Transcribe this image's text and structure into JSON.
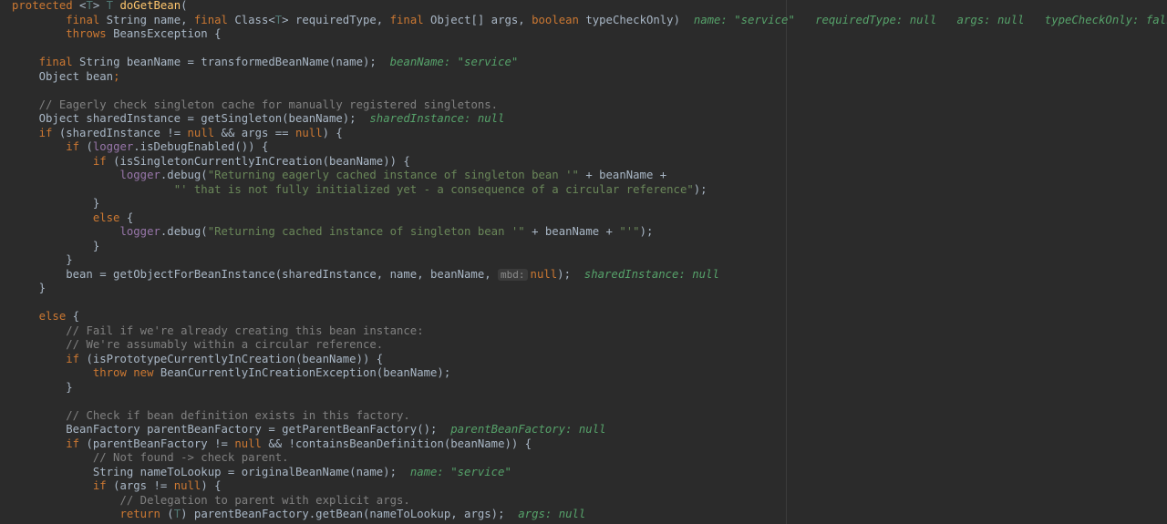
{
  "editor": {
    "lines": [
      [
        [
          "kw",
          "protected "
        ],
        [
          "plain",
          "<"
        ],
        [
          "tp",
          "T"
        ],
        [
          "plain",
          "> "
        ],
        [
          "tp",
          "T "
        ],
        [
          "fn",
          "doGetBean"
        ],
        [
          "plain",
          "("
        ]
      ],
      [
        [
          "plain",
          "        "
        ],
        [
          "kw",
          "final "
        ],
        [
          "plain",
          "String name, "
        ],
        [
          "kw",
          "final "
        ],
        [
          "plain",
          "Class<"
        ],
        [
          "tp",
          "T"
        ],
        [
          "plain",
          "> requiredType, "
        ],
        [
          "kw",
          "final "
        ],
        [
          "plain",
          "Object[] args, "
        ],
        [
          "kw",
          "boolean "
        ],
        [
          "plain",
          "typeCheckOnly)  "
        ],
        [
          "hint",
          "name: \"service\"   requiredType: null   args: null   typeCheckOnly: false"
        ]
      ],
      [
        [
          "plain",
          "        "
        ],
        [
          "kw",
          "throws "
        ],
        [
          "plain",
          "BeansException {"
        ]
      ],
      [
        [
          "plain",
          ""
        ]
      ],
      [
        [
          "plain",
          "    "
        ],
        [
          "kw",
          "final "
        ],
        [
          "plain",
          "String beanName = transformedBeanName(name);  "
        ],
        [
          "hint",
          "beanName: \"service\""
        ]
      ],
      [
        [
          "plain",
          "    Object bean"
        ],
        [
          "kw",
          ";"
        ]
      ],
      [
        [
          "plain",
          ""
        ]
      ],
      [
        [
          "plain",
          "    "
        ],
        [
          "cm",
          "// Eagerly check singleton cache for manually registered singletons."
        ]
      ],
      [
        [
          "plain",
          "    Object sharedInstance = getSingleton(beanName);  "
        ],
        [
          "hint",
          "sharedInstance: null"
        ]
      ],
      [
        [
          "plain",
          "    "
        ],
        [
          "kw",
          "if "
        ],
        [
          "plain",
          "(sharedInstance != "
        ],
        [
          "kw",
          "null "
        ],
        [
          "plain",
          "&& args == "
        ],
        [
          "kw",
          "null"
        ],
        [
          "plain",
          ") {"
        ]
      ],
      [
        [
          "plain",
          "        "
        ],
        [
          "kw",
          "if "
        ],
        [
          "plain",
          "("
        ],
        [
          "fld",
          "logger"
        ],
        [
          "plain",
          ".isDebugEnabled()) {"
        ]
      ],
      [
        [
          "plain",
          "            "
        ],
        [
          "kw",
          "if "
        ],
        [
          "plain",
          "(isSingletonCurrentlyInCreation(beanName)) {"
        ]
      ],
      [
        [
          "plain",
          "                "
        ],
        [
          "fld",
          "logger"
        ],
        [
          "plain",
          ".debug("
        ],
        [
          "str",
          "\"Returning eagerly cached instance of singleton bean '\" "
        ],
        [
          "plain",
          "+ beanName +"
        ]
      ],
      [
        [
          "plain",
          "                        "
        ],
        [
          "str",
          "\"' that is not fully initialized yet - a consequence of a circular reference\""
        ],
        [
          "plain",
          ");"
        ]
      ],
      [
        [
          "plain",
          "            }"
        ]
      ],
      [
        [
          "plain",
          "            "
        ],
        [
          "kw",
          "else "
        ],
        [
          "plain",
          "{"
        ]
      ],
      [
        [
          "plain",
          "                "
        ],
        [
          "fld",
          "logger"
        ],
        [
          "plain",
          ".debug("
        ],
        [
          "str",
          "\"Returning cached instance of singleton bean '\" "
        ],
        [
          "plain",
          "+ beanName + "
        ],
        [
          "str",
          "\"'\""
        ],
        [
          "plain",
          ");"
        ]
      ],
      [
        [
          "plain",
          "            }"
        ]
      ],
      [
        [
          "plain",
          "        }"
        ]
      ],
      [
        [
          "plain",
          "        bean = getObjectForBeanInstance(sharedInstance, name, beanName, "
        ],
        [
          "param",
          "mbd:"
        ],
        [
          "kw",
          "null"
        ],
        [
          "plain",
          ");  "
        ],
        [
          "hint",
          "sharedInstance: null"
        ]
      ],
      [
        [
          "plain",
          "    }"
        ]
      ],
      [
        [
          "plain",
          ""
        ]
      ],
      [
        [
          "plain",
          "    "
        ],
        [
          "kw",
          "else "
        ],
        [
          "plain",
          "{"
        ]
      ],
      [
        [
          "plain",
          "        "
        ],
        [
          "cm",
          "// Fail if we're already creating this bean instance:"
        ]
      ],
      [
        [
          "plain",
          "        "
        ],
        [
          "cm",
          "// We're assumably within a circular reference."
        ]
      ],
      [
        [
          "plain",
          "        "
        ],
        [
          "kw",
          "if "
        ],
        [
          "plain",
          "(isPrototypeCurrentlyInCreation(beanName)) {"
        ]
      ],
      [
        [
          "plain",
          "            "
        ],
        [
          "kw",
          "throw new "
        ],
        [
          "plain",
          "BeanCurrentlyInCreationException(beanName);"
        ]
      ],
      [
        [
          "plain",
          "        }"
        ]
      ],
      [
        [
          "plain",
          ""
        ]
      ],
      [
        [
          "plain",
          "        "
        ],
        [
          "cm",
          "// Check if bean definition exists in this factory."
        ]
      ],
      [
        [
          "plain",
          "        BeanFactory parentBeanFactory = getParentBeanFactory();  "
        ],
        [
          "hint",
          "parentBeanFactory: null"
        ]
      ],
      [
        [
          "plain",
          "        "
        ],
        [
          "kw",
          "if "
        ],
        [
          "plain",
          "(parentBeanFactory != "
        ],
        [
          "kw",
          "null "
        ],
        [
          "plain",
          "&& !containsBeanDefinition(beanName)) {"
        ]
      ],
      [
        [
          "plain",
          "            "
        ],
        [
          "cm",
          "// Not found -> check parent."
        ]
      ],
      [
        [
          "plain",
          "            String nameToLookup = originalBeanName(name);  "
        ],
        [
          "hint",
          "name: \"service\""
        ]
      ],
      [
        [
          "plain",
          "            "
        ],
        [
          "kw",
          "if "
        ],
        [
          "plain",
          "(args != "
        ],
        [
          "kw",
          "null"
        ],
        [
          "plain",
          ") {"
        ]
      ],
      [
        [
          "plain",
          "                "
        ],
        [
          "cm",
          "// Delegation to parent with explicit args."
        ]
      ],
      [
        [
          "plain",
          "                "
        ],
        [
          "kw",
          "return "
        ],
        [
          "plain",
          "("
        ],
        [
          "tp",
          "T"
        ],
        [
          "plain",
          ") parentBeanFactory.getBean(nameToLookup, args);  "
        ],
        [
          "hint",
          "args: null"
        ]
      ]
    ]
  }
}
